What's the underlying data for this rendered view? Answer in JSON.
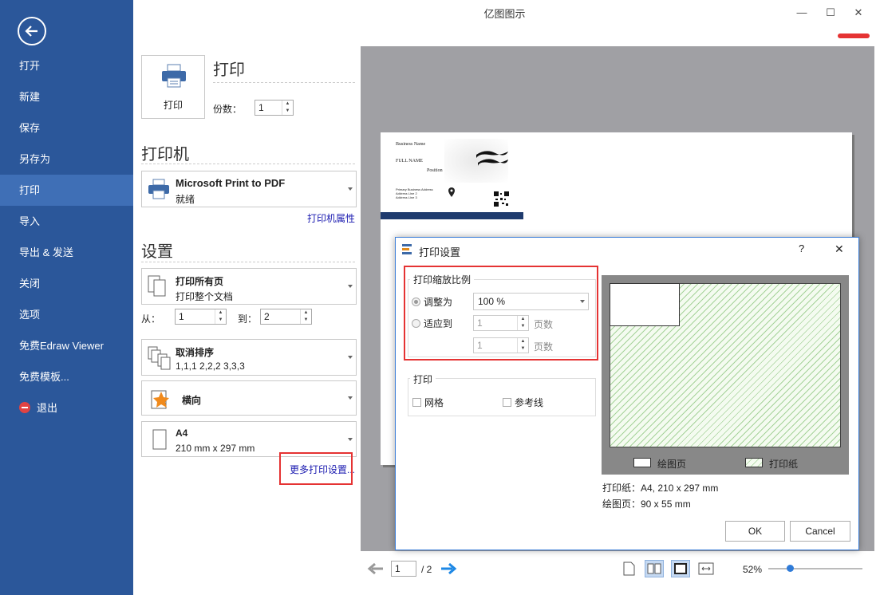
{
  "window": {
    "title": "亿图图示",
    "minimize": "—",
    "maximize": "☐",
    "close": "✕"
  },
  "sidebar": {
    "items": [
      {
        "label": "打开"
      },
      {
        "label": "新建"
      },
      {
        "label": "保存"
      },
      {
        "label": "另存为"
      },
      {
        "label": "打印"
      },
      {
        "label": "导入"
      },
      {
        "label": "导出 & 发送"
      },
      {
        "label": "关闭"
      },
      {
        "label": "选项"
      },
      {
        "label": "免费Edraw Viewer"
      },
      {
        "label": "免费模板..."
      },
      {
        "label": "退出"
      }
    ],
    "active": "打印"
  },
  "print": {
    "title": "打印",
    "button_label": "打印",
    "copies_label": "份数：",
    "copies_value": "1"
  },
  "printer": {
    "heading": "打印机",
    "name": "Microsoft Print to PDF",
    "status": "就绪",
    "properties_link": "打印机属性"
  },
  "settings": {
    "heading": "设置",
    "range_title": "打印所有页",
    "range_sub": "打印整个文档",
    "from_label": "从：",
    "from_value": "1",
    "to_label": "到：",
    "to_value": "2",
    "collate_title": "取消排序",
    "collate_sub": "1,1,1   2,2,2   3,3,3",
    "orientation": "横向",
    "paper_title": "A4",
    "paper_sub": "210 mm x 297 mm",
    "more_link": "更多打印设置..."
  },
  "preview_card": {
    "business_name": "Business Name",
    "full_name": "FULL NAME",
    "position": "Position",
    "address1": "Primary Business Address",
    "address2": "Address Line 2",
    "address3": "Address Line 3"
  },
  "dialog": {
    "title": "打印设置",
    "help": "?",
    "close": "✕",
    "scale_group": "打印缩放比例",
    "adjust_label": "调整为",
    "adjust_value": "100 %",
    "fit_label": "适应到",
    "fit_w": "1",
    "fit_h": "1",
    "pages_label_1": "页数",
    "pages_label_2": "页数",
    "print_group": "打印",
    "grid_label": "网格",
    "guides_label": "参考线",
    "legend_drawing": "绘图页",
    "legend_paper": "打印纸",
    "paper_info": "打印纸：A4, 210 x 297 mm",
    "drawing_info": "绘图页：90 x 55 mm",
    "ok": "OK",
    "cancel": "Cancel"
  },
  "statusbar": {
    "page_value": "1",
    "page_total": "/ 2",
    "zoom": "52%"
  },
  "colors": {
    "sidebar": "#2b579a",
    "sidebar_active": "#3f6fb6",
    "highlight": "#e53333",
    "link": "#1a1ab0"
  }
}
